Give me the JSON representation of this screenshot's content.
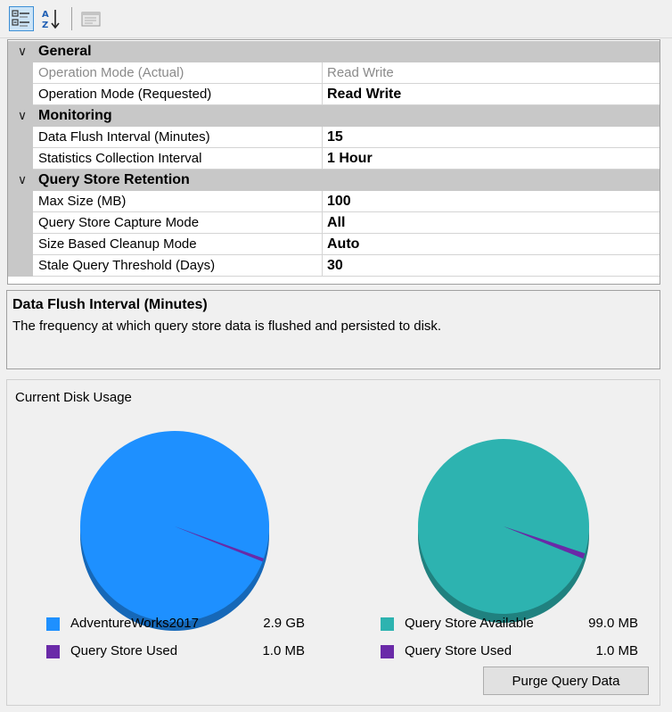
{
  "toolbar": {
    "categorized_icon": "categorized-view-icon",
    "alphabetical_icon": "alphabetical-sort-icon",
    "property_pages_icon": "property-pages-icon"
  },
  "grid": {
    "categories": [
      {
        "label": "General",
        "properties": [
          {
            "name": "Operation Mode (Actual)",
            "value": "Read Write",
            "readonly": true
          },
          {
            "name": "Operation Mode (Requested)",
            "value": "Read Write"
          }
        ]
      },
      {
        "label": "Monitoring",
        "properties": [
          {
            "name": "Data Flush Interval (Minutes)",
            "value": "15"
          },
          {
            "name": "Statistics Collection Interval",
            "value": "1 Hour"
          }
        ]
      },
      {
        "label": "Query Store Retention",
        "properties": [
          {
            "name": "Max Size (MB)",
            "value": "100"
          },
          {
            "name": "Query Store Capture Mode",
            "value": "All"
          },
          {
            "name": "Size Based Cleanup Mode",
            "value": "Auto"
          },
          {
            "name": "Stale Query Threshold (Days)",
            "value": "30"
          }
        ]
      }
    ]
  },
  "description": {
    "title": "Data Flush Interval (Minutes)",
    "text": "The frequency at which query store data is flushed and persisted to disk."
  },
  "disk_usage": {
    "title": "Current Disk Usage",
    "purge_label": "Purge Query Data",
    "colors": {
      "database": "#1e90ff",
      "qs_used": "#6a2aa8",
      "qs_available": "#2db3b0"
    }
  },
  "chart_data": [
    {
      "type": "pie",
      "series": [
        {
          "name": "AdventureWorks2017",
          "label": "2.9 GB",
          "value": 2.9,
          "unit": "GB"
        },
        {
          "name": "Query Store Used",
          "label": "1.0 MB",
          "value": 0.001,
          "unit": "GB"
        }
      ]
    },
    {
      "type": "pie",
      "series": [
        {
          "name": "Query Store Available",
          "label": "99.0 MB",
          "value": 99.0,
          "unit": "MB"
        },
        {
          "name": "Query Store Used",
          "label": "1.0 MB",
          "value": 1.0,
          "unit": "MB"
        }
      ]
    }
  ]
}
